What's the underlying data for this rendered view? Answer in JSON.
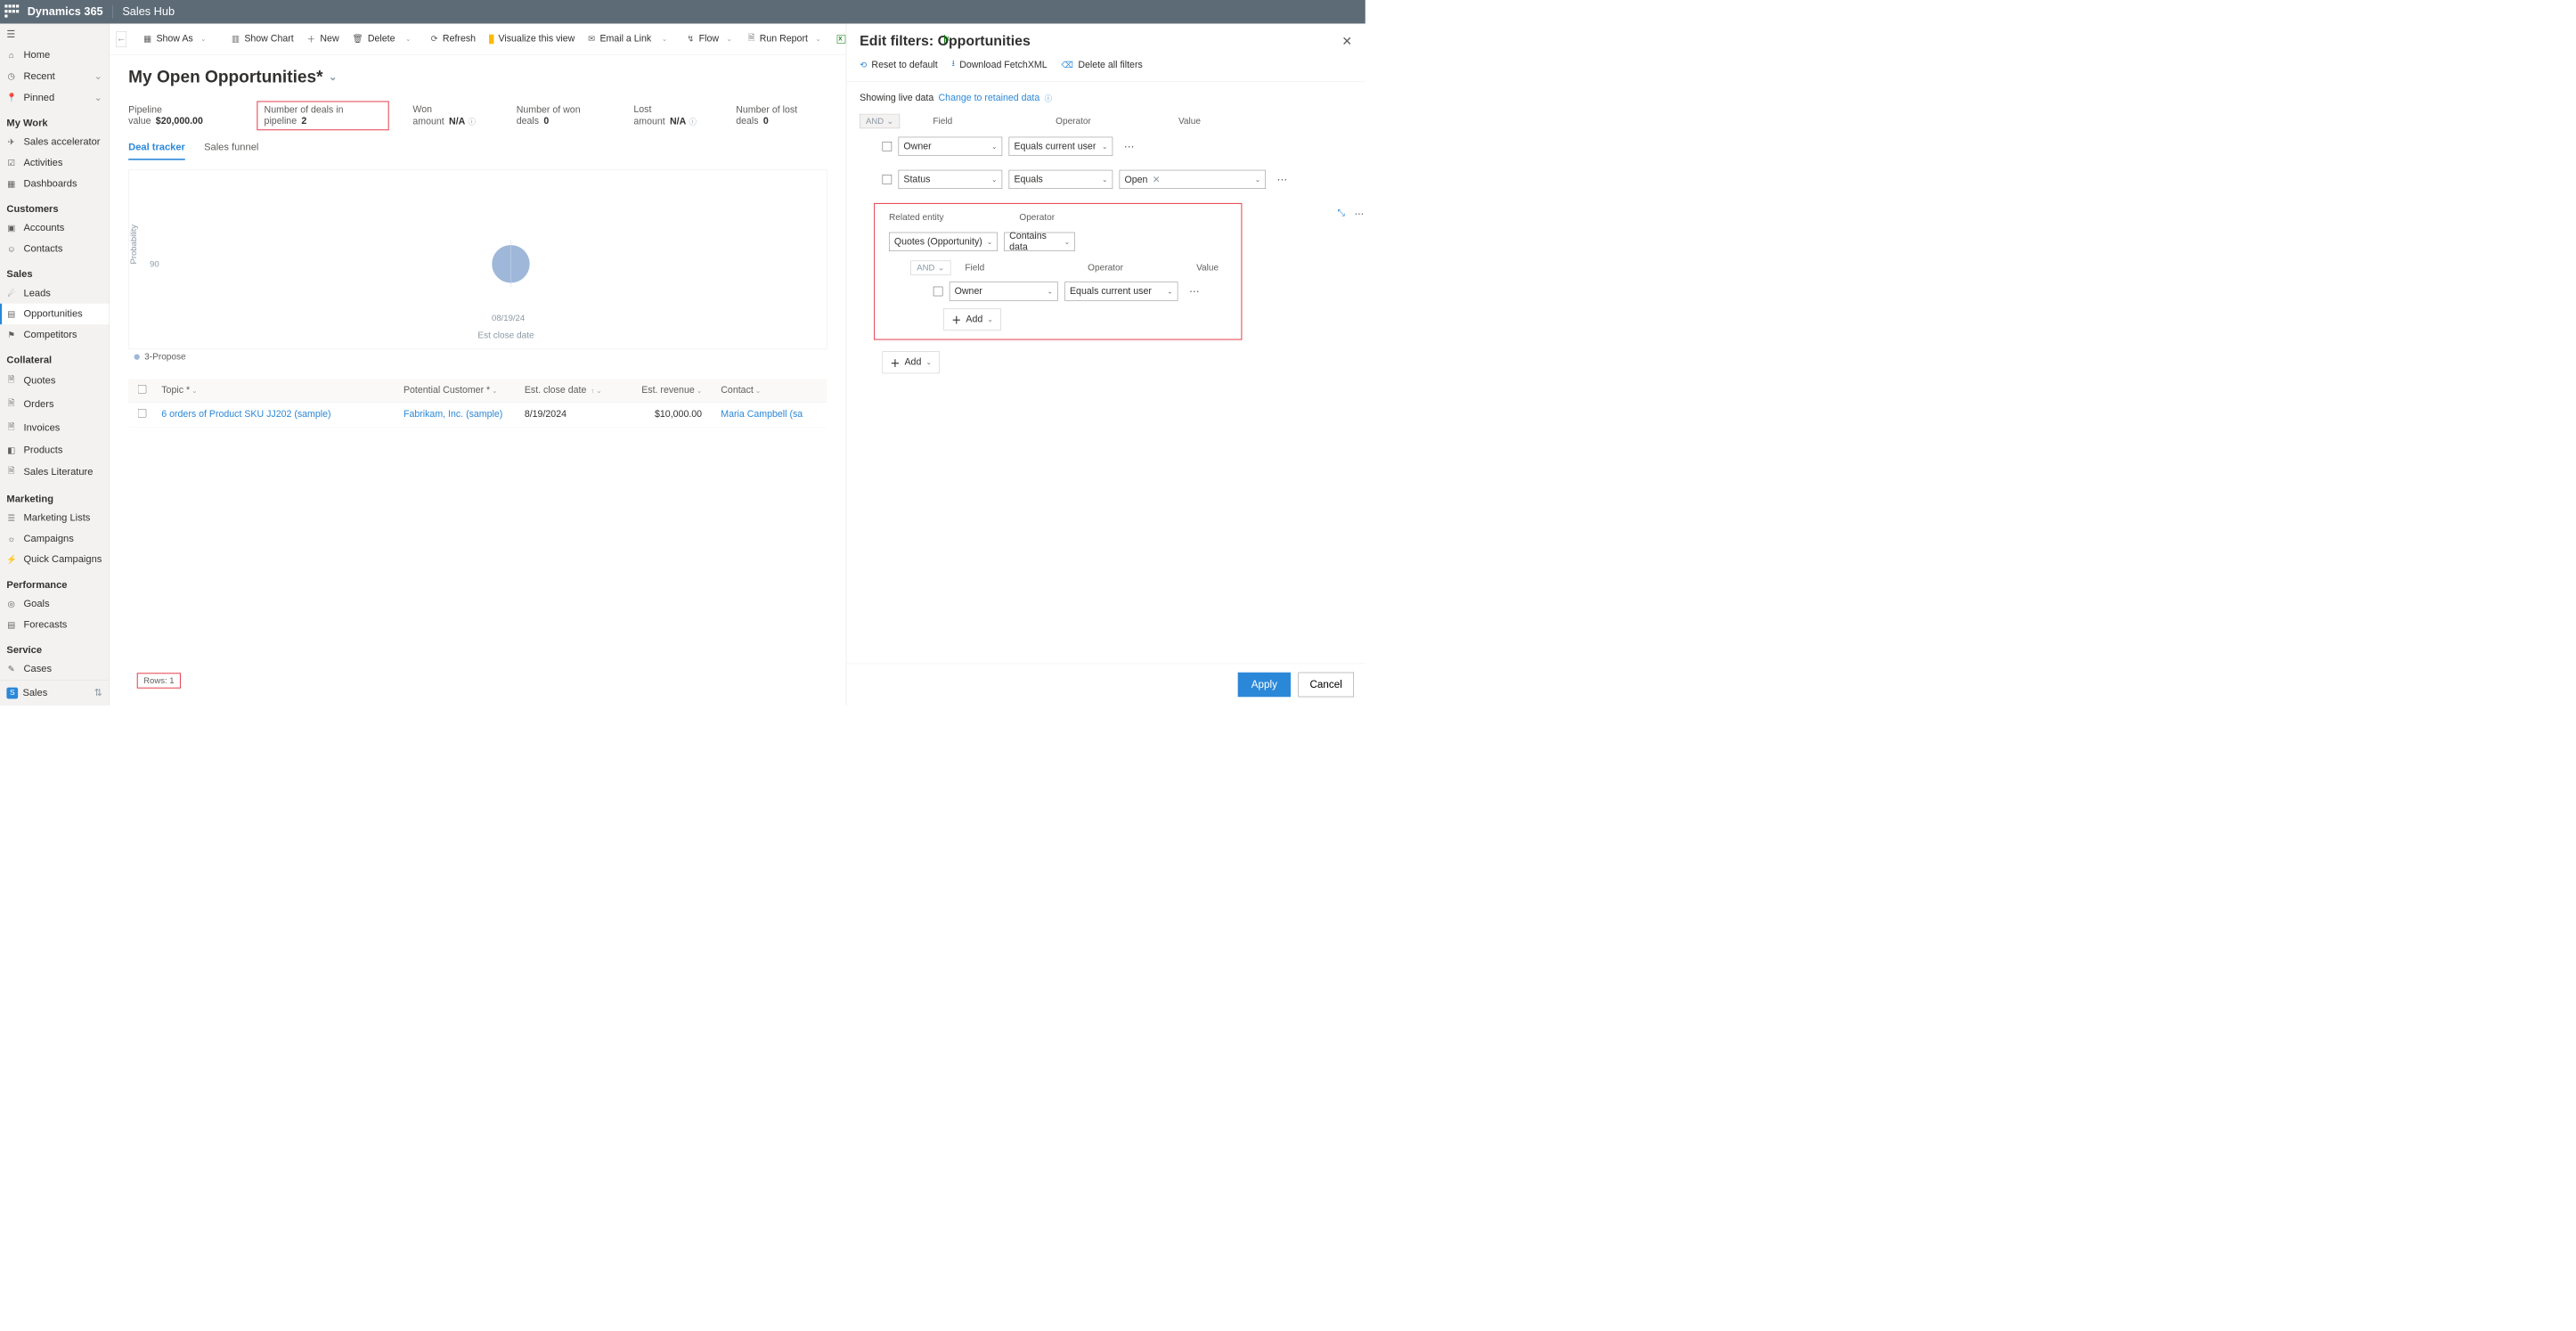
{
  "topbar": {
    "brand": "Dynamics 365",
    "app": "Sales Hub"
  },
  "nav": {
    "home": "Home",
    "recent": "Recent",
    "pinned": "Pinned",
    "g_mywork": "My Work",
    "salesacc": "Sales accelerator",
    "activities": "Activities",
    "dashboards": "Dashboards",
    "g_customers": "Customers",
    "accounts": "Accounts",
    "contacts": "Contacts",
    "g_sales": "Sales",
    "leads": "Leads",
    "opps": "Opportunities",
    "competitors": "Competitors",
    "g_collateral": "Collateral",
    "quotes": "Quotes",
    "orders": "Orders",
    "invoices": "Invoices",
    "products": "Products",
    "saleslit": "Sales Literature",
    "g_marketing": "Marketing",
    "mlists": "Marketing Lists",
    "campaigns": "Campaigns",
    "qcampaigns": "Quick Campaigns",
    "g_performance": "Performance",
    "goals": "Goals",
    "forecasts": "Forecasts",
    "g_service": "Service",
    "cases": "Cases",
    "footer": "Sales",
    "footer_badge": "S"
  },
  "cmd": {
    "showas": "Show As",
    "showchart": "Show Chart",
    "new": "New",
    "delete": "Delete",
    "refresh": "Refresh",
    "visualize": "Visualize this view",
    "email": "Email a Link",
    "flow": "Flow",
    "runreport": "Run Report",
    "excel": "Excel Templates"
  },
  "view": {
    "title": "My Open Opportunities*",
    "stats": {
      "pv_l": "Pipeline value",
      "pv_v": "$20,000.00",
      "nd_l": "Number of deals in pipeline",
      "nd_v": "2",
      "wa_l": "Won amount",
      "wa_v": "N/A",
      "nw_l": "Number of won deals",
      "nw_v": "0",
      "la_l": "Lost amount",
      "la_v": "N/A",
      "nl_l": "Number of lost deals",
      "nl_v": "0"
    },
    "tab_deal": "Deal tracker",
    "tab_funnel": "Sales funnel",
    "chart": {
      "ylabel": "Probability",
      "ytick": "90",
      "xdate": "08/19/24",
      "xlabel": "Est close date",
      "legend": "3-Propose"
    },
    "cols": {
      "topic": "Topic *",
      "cust": "Potential Customer *",
      "date": "Est. close date",
      "rev": "Est. revenue",
      "contact": "Contact"
    },
    "row": {
      "topic": "6 orders of Product SKU JJ202 (sample)",
      "cust": "Fabrikam, Inc. (sample)",
      "date": "8/19/2024",
      "rev": "$10,000.00",
      "contact": "Maria Campbell (sa"
    },
    "footer": "Rows: 1"
  },
  "panel": {
    "title": "Edit filters: Opportunities",
    "reset": "Reset to default",
    "fetch": "Download FetchXML",
    "delall": "Delete all filters",
    "live_l": "Showing live data",
    "live_a": "Change to retained data",
    "and": "AND",
    "hdr_field": "Field",
    "hdr_op": "Operator",
    "hdr_val": "Value",
    "r1_field": "Owner",
    "r1_op": "Equals current user",
    "r2_field": "Status",
    "r2_op": "Equals",
    "r2_val": "Open",
    "rel_lbl": "Related entity",
    "rel_oplbl": "Operator",
    "rel_field": "Quotes (Opportunity)",
    "rel_op": "Contains data",
    "nested_and": "AND",
    "nested_field_h": "Field",
    "nested_op_h": "Operator",
    "nested_val_h": "Value",
    "nested_field": "Owner",
    "nested_op": "Equals current user",
    "add": "Add",
    "apply": "Apply",
    "cancel": "Cancel"
  }
}
